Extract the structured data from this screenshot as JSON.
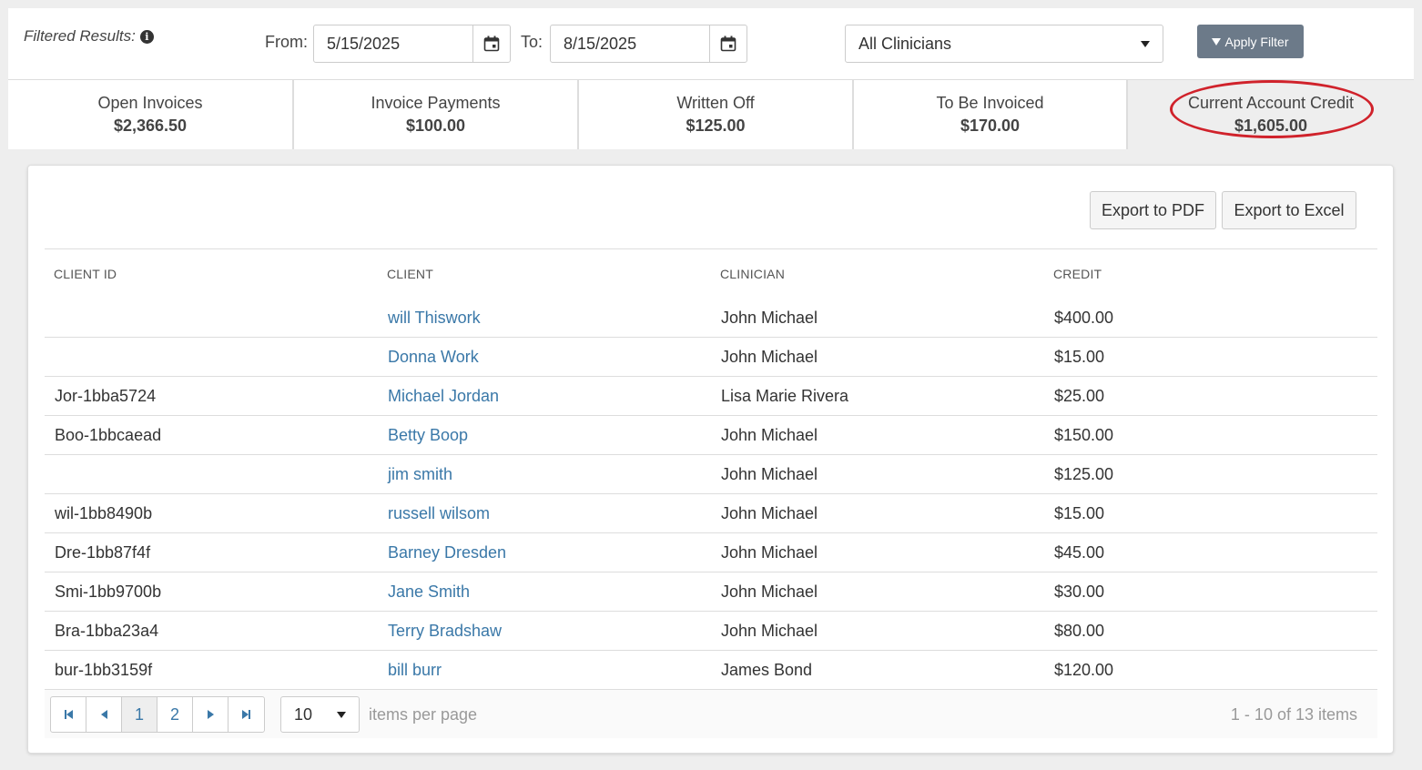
{
  "filter": {
    "label": "Filtered Results:",
    "from_label": "From:",
    "from_value": "5/15/2025",
    "to_label": "To:",
    "to_value": "8/15/2025",
    "clinician_selected": "All Clinicians",
    "apply_label": "Apply Filter"
  },
  "summary": [
    {
      "title": "Open Invoices",
      "value": "$2,366.50"
    },
    {
      "title": "Invoice Payments",
      "value": "$100.00"
    },
    {
      "title": "Written Off",
      "value": "$125.00"
    },
    {
      "title": "To Be Invoiced",
      "value": "$170.00"
    },
    {
      "title": "Current Account Credit",
      "value": "$1,605.00"
    }
  ],
  "highlight_color": "#d0222b",
  "link_color": "#3a78a8",
  "toolbar": {
    "export_pdf": "Export to PDF",
    "export_excel": "Export to Excel"
  },
  "grid": {
    "headers": [
      "CLIENT ID",
      "CLIENT",
      "CLINICIAN",
      "CREDIT"
    ],
    "rows": [
      {
        "id": "",
        "client": "will Thiswork",
        "clinician": "John Michael",
        "credit": "$400.00"
      },
      {
        "id": "",
        "client": "Donna Work",
        "clinician": "John Michael",
        "credit": "$15.00"
      },
      {
        "id": "Jor-1bba5724",
        "client": "Michael Jordan",
        "clinician": "Lisa Marie Rivera",
        "credit": "$25.00"
      },
      {
        "id": "Boo-1bbcaead",
        "client": "Betty Boop",
        "clinician": "John Michael",
        "credit": "$150.00"
      },
      {
        "id": "",
        "client": "jim smith",
        "clinician": "John Michael",
        "credit": "$125.00"
      },
      {
        "id": "wil-1bb8490b",
        "client": "russell wilsom",
        "clinician": "John Michael",
        "credit": "$15.00"
      },
      {
        "id": "Dre-1bb87f4f",
        "client": "Barney Dresden",
        "clinician": "John Michael",
        "credit": "$45.00"
      },
      {
        "id": "Smi-1bb9700b",
        "client": "Jane Smith",
        "clinician": "John Michael",
        "credit": "$30.00"
      },
      {
        "id": "Bra-1bba23a4",
        "client": "Terry Bradshaw",
        "clinician": "John Michael",
        "credit": "$80.00"
      },
      {
        "id": "bur-1bb3159f",
        "client": "bill burr",
        "clinician": "James Bond",
        "credit": "$120.00"
      }
    ]
  },
  "pager": {
    "pages": [
      "1",
      "2"
    ],
    "current_page": "1",
    "page_size": "10",
    "per_page_label": "items per page",
    "count_label": "1 - 10 of 13 items"
  }
}
